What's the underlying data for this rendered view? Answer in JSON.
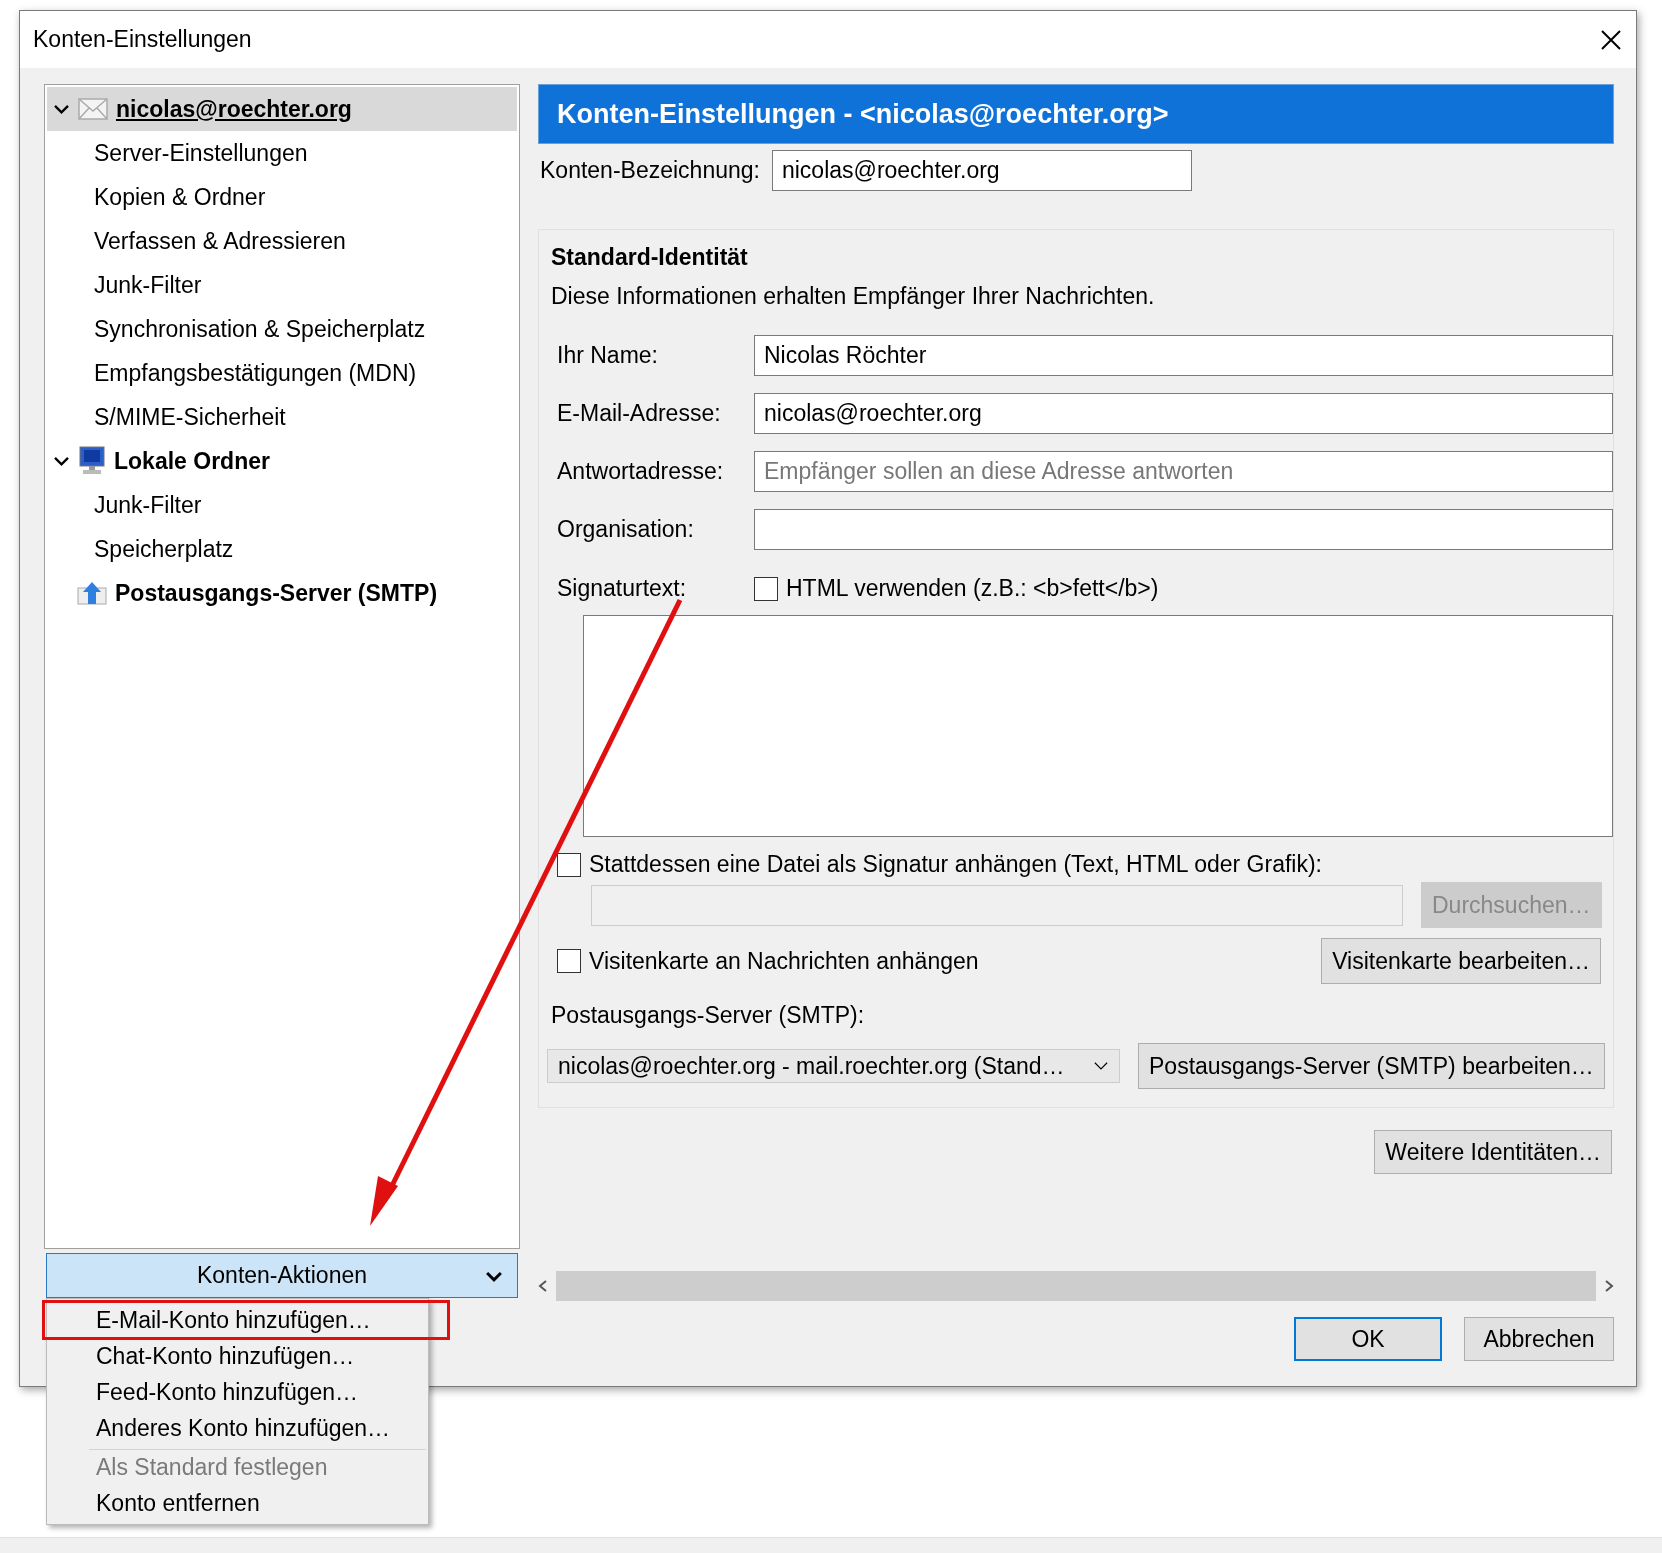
{
  "dialog": {
    "title": "Konten-Einstellungen"
  },
  "tree": [
    {
      "label": "nicolas@roechter.org",
      "kind": "mail",
      "expanded": true,
      "selected": true,
      "children": [
        {
          "label": "Server-Einstellungen",
          "selected": false
        },
        {
          "label": "Kopien & Ordner",
          "selected": false
        },
        {
          "label": "Verfassen & Adressieren",
          "selected": false
        },
        {
          "label": "Junk-Filter",
          "selected": false
        },
        {
          "label": "Synchronisation & Speicherplatz",
          "selected": false
        },
        {
          "label": "Empfangsbestätigungen (MDN)",
          "selected": false
        },
        {
          "label": "S/MIME-Sicherheit",
          "selected": false
        }
      ]
    },
    {
      "label": "Lokale Ordner",
      "kind": "computer",
      "expanded": true,
      "selected": false,
      "children": [
        {
          "label": "Junk-Filter",
          "selected": false
        },
        {
          "label": "Speicherplatz",
          "selected": false
        }
      ]
    },
    {
      "label": "Postausgangs-Server (SMTP)",
      "kind": "outbox",
      "selected": false
    }
  ],
  "account_actions": {
    "label": "Konten-Aktionen",
    "expanded": true
  },
  "menu": [
    {
      "label": "E-Mail-Konto hinzufügen…",
      "disabled": false,
      "highlighted": true,
      "separator_before": false
    },
    {
      "label": "Chat-Konto hinzufügen…",
      "disabled": false,
      "highlighted": false,
      "separator_before": false
    },
    {
      "label": "Feed-Konto hinzufügen…",
      "disabled": false,
      "highlighted": false,
      "separator_before": false
    },
    {
      "label": "Anderes Konto hinzufügen…",
      "disabled": false,
      "highlighted": false,
      "separator_before": false
    },
    {
      "label": "Als Standard festlegen",
      "disabled": true,
      "highlighted": false,
      "separator_before": true
    },
    {
      "label": "Konto entfernen",
      "disabled": false,
      "highlighted": false,
      "separator_before": false
    }
  ],
  "header": "Konten-Einstellungen - <nicolas@roechter.org>",
  "account_name": {
    "label": "Konten-Bezeichnung:",
    "value": "nicolas@roechter.org"
  },
  "identity": {
    "title": "Standard-Identität",
    "description": "Diese Informationen erhalten Empfänger Ihrer Nachrichten.",
    "fields": [
      {
        "label": "Ihr Name:",
        "value": "Nicolas Röchter"
      },
      {
        "label": "E-Mail-Adresse:",
        "value": "nicolas@roechter.org"
      },
      {
        "label": "Antwortadresse:",
        "placeholder": "Empfänger sollen an diese Adresse antworten"
      },
      {
        "label": "Organisation:"
      }
    ],
    "signature_label": "Signaturtext:",
    "html_checkbox": {
      "label": "HTML verwenden (z.B.: <b>fett</b>)",
      "checked": false
    },
    "attach_file": {
      "label": "Stattdessen eine Datei als Signatur anhängen (Text, HTML oder Grafik):",
      "checked": false
    },
    "browse_button": {
      "label": "Durchsuchen…",
      "disabled": true
    },
    "vcard": {
      "label": "Visitenkarte an Nachrichten anhängen",
      "checked": false
    },
    "vcard_button": "Visitenkarte bearbeiten…",
    "smtp_label": "Postausgangs-Server (SMTP):",
    "smtp_select": "nicolas@roechter.org - mail.roechter.org (Stand…",
    "smtp_button": "Postausgangs-Server (SMTP) bearbeiten…"
  },
  "more_identities": "Weitere Identitäten…",
  "buttons": [
    {
      "label": "OK",
      "default": true
    },
    {
      "label": "Abbrechen",
      "default": false
    }
  ]
}
